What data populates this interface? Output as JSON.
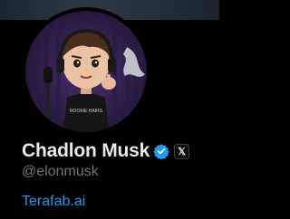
{
  "profile": {
    "display_name": "Chadlon Musk",
    "handle": "@elonmusk",
    "website": "Terafab.ai",
    "avatar_caption": "ROOKIE HAIRS",
    "verified_icon": "verified-badge-icon",
    "affiliate_icon": "x-logo-icon",
    "affiliate_glyph": "𝕏"
  },
  "colors": {
    "background": "#000000",
    "name": "#e7e9ea",
    "handle": "#71767b",
    "link": "#1d9bf0",
    "verified": "#1d9bf0"
  }
}
